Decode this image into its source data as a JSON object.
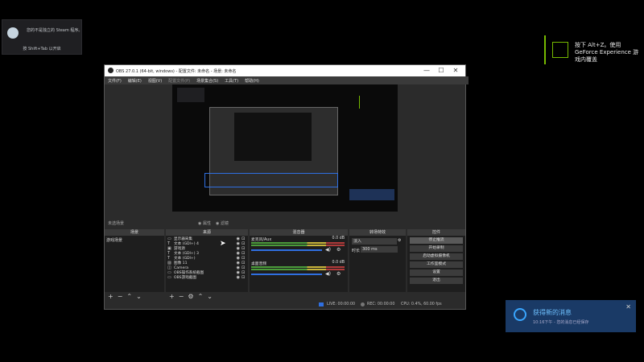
{
  "steam_toast": {
    "message": "您的不是独立的 Steam 程序。",
    "hint": "按 Shift+Tab 以开启"
  },
  "gfe_toast": {
    "text": "按下 Alt+Z。使用 GeForce Experience 游戏内覆盖"
  },
  "obs": {
    "title": "OBS 27.0.1 (64-bit, windows) - 配置文件: 未命名 - 场景: 未命名",
    "window_buttons": [
      "—",
      "☐",
      "✕"
    ],
    "menu": [
      "文件(F)",
      "编辑(E)",
      "视图(V)",
      "配置文件(P)",
      "场景集合(S)",
      "工具(T)",
      "帮助(H)"
    ],
    "scene_label": "未选场景",
    "radio_labels": [
      "属性",
      "滤镜"
    ],
    "docks": {
      "scenes": {
        "title": "场景",
        "items": [
          "游戏场景"
        ]
      },
      "sources": {
        "title": "来源",
        "items": [
          "显示器采集",
          "文本 (GDI+) 4",
          "游戏源",
          "文本 (GDI+) 3",
          "文本 (GDI+)",
          "图像 11",
          "Camera",
          "OBS操作系统截图",
          "OBS游戏截图"
        ]
      },
      "mixer": {
        "title": "混音器",
        "tracks": [
          {
            "name": "麦克风/Aux",
            "level": "0.0 dB"
          },
          {
            "name": "桌面音频",
            "level": "0.0 dB"
          }
        ]
      },
      "transitions": {
        "title": "转场特效",
        "type": "淡入",
        "duration_label": "时长",
        "duration_value": "300 ms"
      },
      "controls": {
        "title": "控件",
        "buttons": [
          "停止推流",
          "开始录制",
          "启动虚拟摄像机",
          "工作室模式",
          "设置",
          "退出"
        ]
      }
    },
    "status": {
      "live": "LIVE: 00:00:00",
      "rec": "REC: 00:00:00",
      "cpu": "CPU: 0.4%, 60.00 fps"
    }
  },
  "msg_toast": {
    "title": "获得新的消息",
    "subtitle": "10:16下午 - 您的消息已经保存"
  },
  "colors": {
    "accent_green": "#76b900",
    "obs_blue": "#2f6fe0",
    "toast_blue": "#1a3a66"
  }
}
